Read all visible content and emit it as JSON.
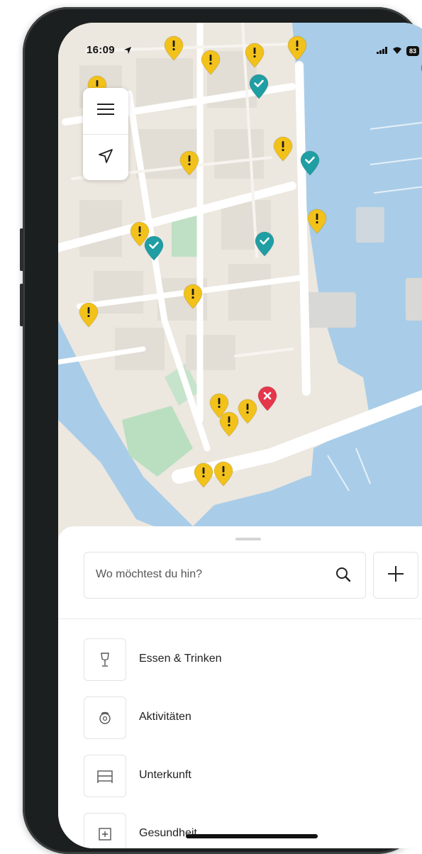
{
  "status_bar": {
    "time": "16:09",
    "battery": "83"
  },
  "map_controls": {
    "menu_icon": "hamburger-menu-icon",
    "locate_icon": "navigation-arrow-icon"
  },
  "pins": {
    "warning_icon": "exclamation-icon",
    "checked_icon": "checkmark-icon",
    "blocked_icon": "cross-icon",
    "colors": {
      "warning": "#f2c21b",
      "checked": "#1f9ea3",
      "blocked": "#e5364b"
    }
  },
  "search": {
    "placeholder": "Wo möchtest du hin?",
    "icon": "search-icon"
  },
  "add_button": {
    "icon": "plus-icon"
  },
  "categories": [
    {
      "label": "Essen & Trinken",
      "icon": "drink-glass-icon"
    },
    {
      "label": "Aktivitäten",
      "icon": "activity-hand-icon"
    },
    {
      "label": "Unterkunft",
      "icon": "bed-icon"
    },
    {
      "label": "Gesundheit",
      "icon": "medical-plus-icon"
    }
  ]
}
